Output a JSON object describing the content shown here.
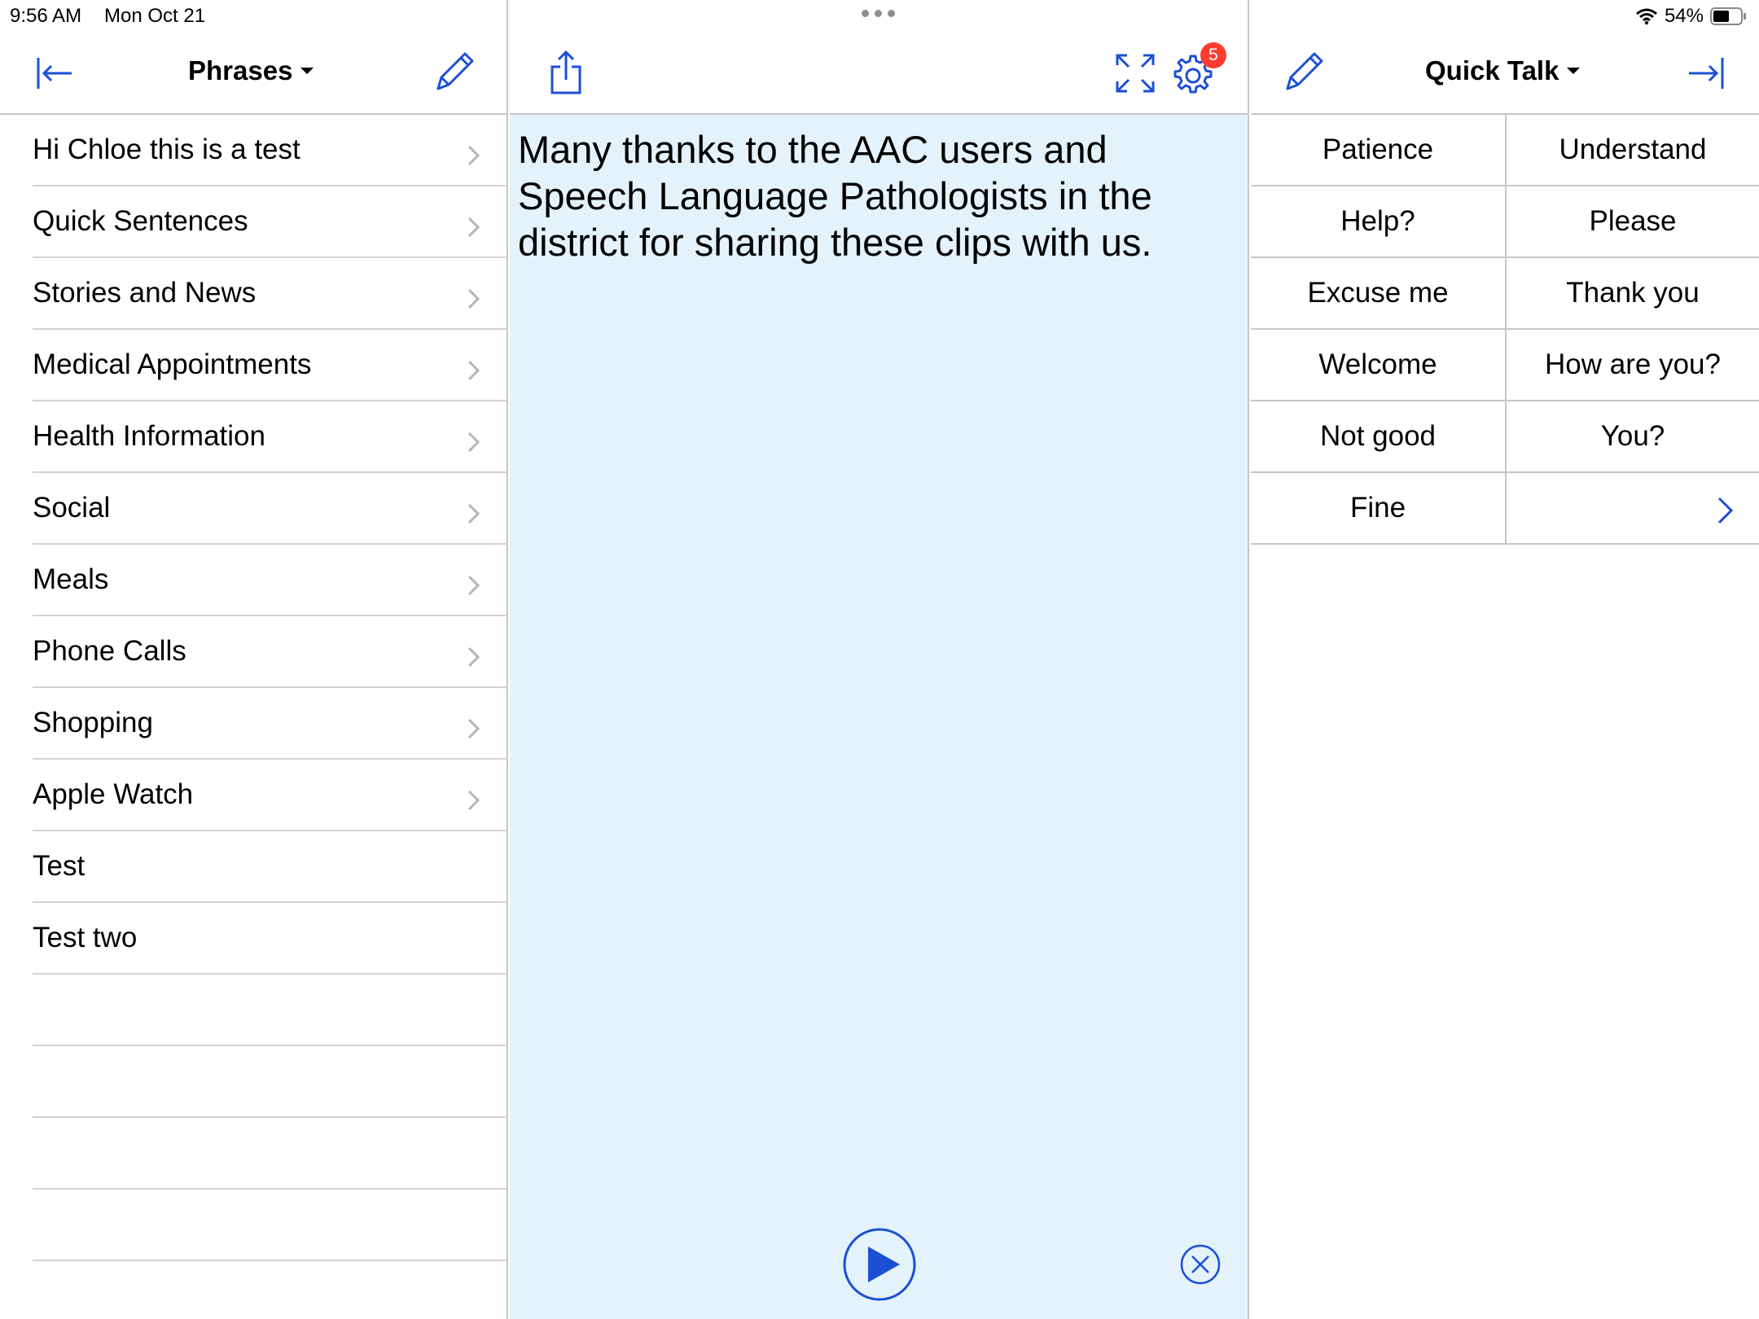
{
  "status_bar": {
    "time": "9:56 AM",
    "date": "Mon Oct 21",
    "battery": "54%",
    "icons": [
      "wifi-icon",
      "battery-icon"
    ]
  },
  "left_panel": {
    "title": "Phrases",
    "icons": [
      "collapse-left-icon",
      "edit-pencil-icon",
      "dropdown-caret-icon",
      "chevron-right-icon"
    ],
    "items": [
      {
        "label": "Hi Chloe this is a test",
        "has_chevron": true
      },
      {
        "label": "Quick Sentences",
        "has_chevron": true
      },
      {
        "label": "Stories and News",
        "has_chevron": true
      },
      {
        "label": "Medical Appointments",
        "has_chevron": true
      },
      {
        "label": "Health Information",
        "has_chevron": true
      },
      {
        "label": "Social",
        "has_chevron": true
      },
      {
        "label": "Meals",
        "has_chevron": true
      },
      {
        "label": "Phone Calls",
        "has_chevron": true
      },
      {
        "label": "Shopping",
        "has_chevron": true
      },
      {
        "label": "Apple Watch",
        "has_chevron": true
      },
      {
        "label": "Test",
        "has_chevron": false
      },
      {
        "label": "Test two",
        "has_chevron": false
      }
    ]
  },
  "middle_panel": {
    "message": "Many thanks to the AAC users and Speech Language Pathologists in the district for sharing these clips with us.",
    "settings_badge": "5",
    "icons": [
      "share-icon",
      "expand-icon",
      "gear-icon",
      "play-icon",
      "clear-x-icon"
    ]
  },
  "right_panel": {
    "title": "Quick Talk",
    "icons": [
      "edit-pencil-icon",
      "collapse-right-icon",
      "dropdown-caret-icon",
      "chevron-right-icon"
    ],
    "grid": [
      [
        "Patience",
        "Understand"
      ],
      [
        "Help?",
        "Please"
      ],
      [
        "Excuse me",
        "Thank you"
      ],
      [
        "Welcome",
        "How are you?"
      ],
      [
        "Not good",
        "You?"
      ],
      [
        "Fine",
        ""
      ]
    ]
  },
  "colors": {
    "accent": "#1a4fd6",
    "badge": "#ff3b30",
    "message_background": "#e4f3fb",
    "separator": "#c6c6c8"
  }
}
